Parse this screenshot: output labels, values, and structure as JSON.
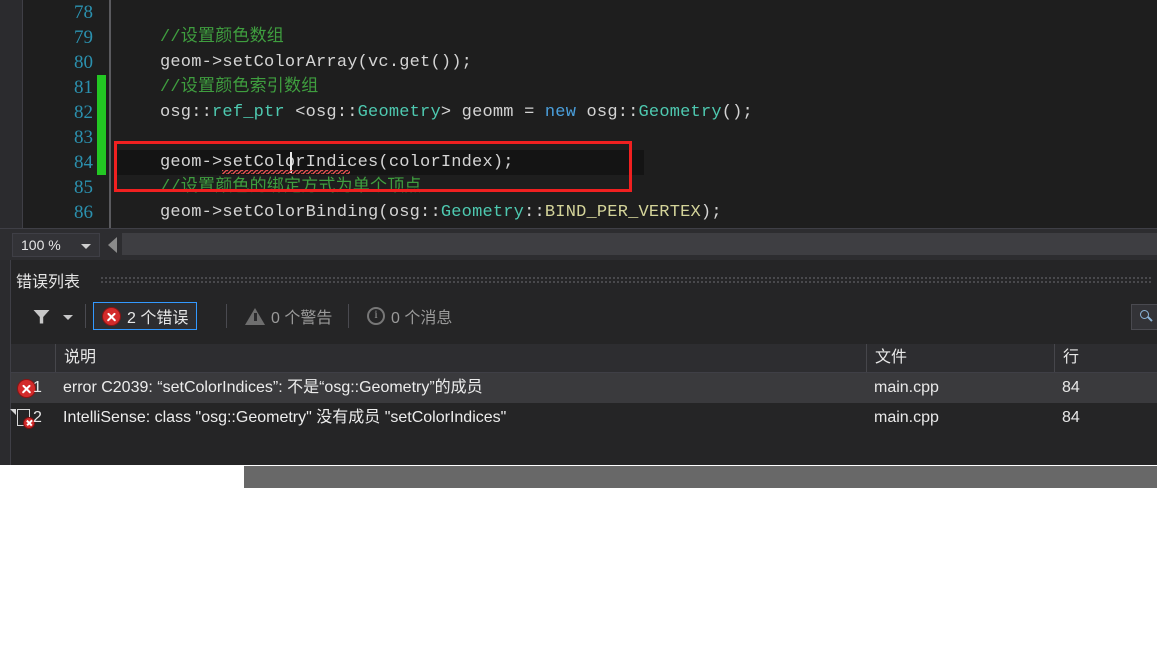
{
  "editor": {
    "zoom_level": "100 %",
    "lines": [
      {
        "number": "78",
        "changed": false,
        "tokens": []
      },
      {
        "number": "79",
        "changed": false,
        "tokens": [
          {
            "t": "//设置颜色数组",
            "c": "c-comment"
          }
        ]
      },
      {
        "number": "80",
        "changed": false,
        "tokens": [
          {
            "t": "geom->setColorArray(vc.get());",
            "c": "c-plain"
          }
        ]
      },
      {
        "number": "81",
        "changed": true,
        "tokens": [
          {
            "t": "//设置颜色索引数组",
            "c": "c-comment"
          }
        ]
      },
      {
        "number": "82",
        "changed": true,
        "tokens": [
          {
            "t": "osg::",
            "c": "c-plain"
          },
          {
            "t": "ref_ptr",
            "c": "c-type"
          },
          {
            "t": " <osg::",
            "c": "c-plain"
          },
          {
            "t": "Geometry",
            "c": "c-type"
          },
          {
            "t": "> geomm = ",
            "c": "c-plain"
          },
          {
            "t": "new",
            "c": "c-key"
          },
          {
            "t": " osg::",
            "c": "c-plain"
          },
          {
            "t": "Geometry",
            "c": "c-type"
          },
          {
            "t": "();",
            "c": "c-plain"
          }
        ]
      },
      {
        "number": "83",
        "changed": true,
        "tokens": []
      },
      {
        "number": "84",
        "changed": true,
        "highlighted": true,
        "tokens": [
          {
            "t": "geom->setColorIndices(colorIndex);",
            "c": "c-plain"
          }
        ]
      },
      {
        "number": "85",
        "changed": false,
        "tokens": [
          {
            "t": "//设置颜色的绑定方式为单个顶点",
            "c": "c-comment"
          }
        ]
      },
      {
        "number": "86",
        "changed": false,
        "tokens": [
          {
            "t": "geom->setColorBinding(osg::",
            "c": "c-plain"
          },
          {
            "t": "Geometry",
            "c": "c-type"
          },
          {
            "t": "::",
            "c": "c-plain"
          },
          {
            "t": "BIND_PER_VERTEX",
            "c": "c-const"
          },
          {
            "t": ");",
            "c": "c-plain"
          }
        ]
      }
    ]
  },
  "error_panel": {
    "title": "错误列表",
    "toolbar": {
      "filter_icon": "filter-funnel-icon",
      "errors_label": "2 个错误",
      "warnings_label": "0 个警告",
      "messages_label": "0 个消息",
      "search_icon": "search-icon"
    },
    "columns": {
      "index": "",
      "description": "说明",
      "file": "文件",
      "line": "行"
    },
    "rows": [
      {
        "icon": "error-circle-icon",
        "index": "1",
        "description": "error C2039: “setColorIndices”: 不是“osg::Geometry”的成员",
        "file": "main.cpp",
        "line": "84",
        "selected": true
      },
      {
        "icon": "intellisense-document-error-icon",
        "index": "2",
        "description": "IntelliSense:  class \"osg::Geometry\" 没有成员 \"setColorIndices\"",
        "file": "main.cpp",
        "line": "84",
        "selected": false
      }
    ]
  },
  "colors": {
    "error_red": "#d32b2b",
    "highlight_box": "#f02020",
    "change_bar_green": "#23c723",
    "accent_blue": "#3399ff",
    "line_number": "#2b91af",
    "comment_green": "#3f9e3f",
    "type_teal": "#4ec9b0",
    "keyword_blue": "#4a9fdc",
    "constant_khaki": "#d4d49a"
  }
}
